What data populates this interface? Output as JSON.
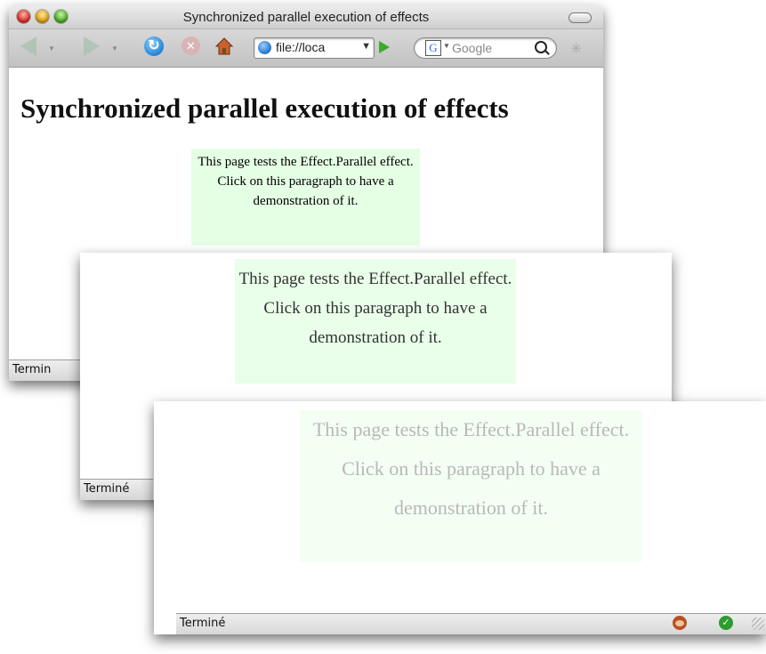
{
  "window": {
    "title": "Synchronized parallel execution of effects",
    "url": "file://loca",
    "search_placeholder": "Google",
    "search_engine_badge": "G"
  },
  "page": {
    "heading": "Synchronized parallel execution of effects",
    "paragraph": "This page tests the Effect.Parallel effect. Click on this paragraph to have a demonstration of it."
  },
  "statusbar": {
    "text": "Terminé",
    "w1_text": "Termin"
  },
  "icons": {
    "back": "back-arrow-icon",
    "forward": "forward-arrow-icon",
    "reload": "reload-icon",
    "stop": "stop-icon",
    "home": "home-icon",
    "go": "go-icon",
    "search": "magnifier-icon",
    "throbber": "throbber-icon",
    "monkey": "greasemonkey-icon",
    "check": "check-icon"
  },
  "colors": {
    "paragraph_bg": "#e5ffe5",
    "reload_blue": "#2a8ad8",
    "go_green": "#3caa2b"
  }
}
